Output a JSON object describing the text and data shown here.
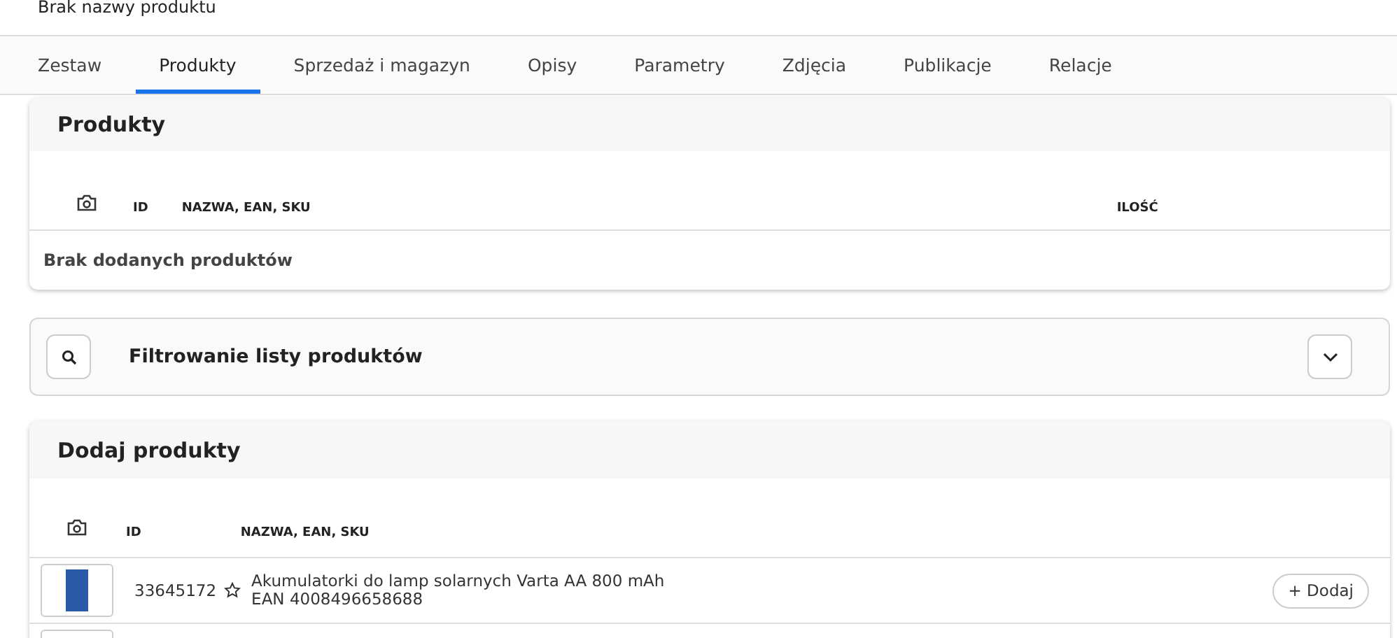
{
  "header": {
    "title": "Brak nazwy produktu"
  },
  "tabs": [
    {
      "label": "Zestaw",
      "selected": false
    },
    {
      "label": "Produkty",
      "selected": true
    },
    {
      "label": "Sprzedaż i magazyn",
      "selected": false
    },
    {
      "label": "Opisy",
      "selected": false
    },
    {
      "label": "Parametry",
      "selected": false
    },
    {
      "label": "Zdjęcia",
      "selected": false
    },
    {
      "label": "Publikacje",
      "selected": false
    },
    {
      "label": "Relacje",
      "selected": false
    }
  ],
  "products_card": {
    "title": "Produkty",
    "columns": [
      "ID",
      "NAZWA, EAN, SKU",
      "ILOŚĆ"
    ],
    "empty_text": "Brak dodanych produktów"
  },
  "filter": {
    "title": "Filtrowanie listy produktów",
    "expanded": false
  },
  "add_card": {
    "title": "Dodaj produkty",
    "columns": [
      "ID",
      "NAZWA, EAN, SKU"
    ],
    "rows": [
      {
        "id": "33645172",
        "name": "Akumulatorki do lamp solarnych Varta AA 800 mAh",
        "ean": "EAN 4008496658688",
        "action": "+ Dodaj"
      },
      {
        "id": "",
        "name": "",
        "ean": "",
        "action": ""
      }
    ]
  }
}
